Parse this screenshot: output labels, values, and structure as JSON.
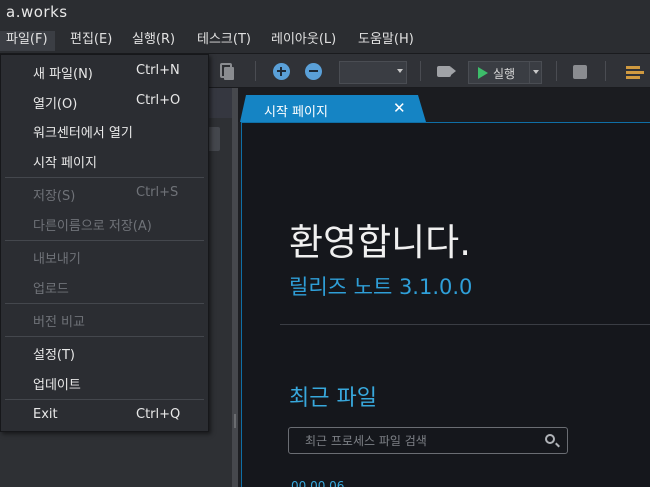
{
  "app": {
    "title": "a.works"
  },
  "menubar": [
    {
      "label": "파일(F)"
    },
    {
      "label": "편집(E)"
    },
    {
      "label": "실행(R)"
    },
    {
      "label": "테스크(T)"
    },
    {
      "label": "레이아웃(L)"
    },
    {
      "label": "도움말(H)"
    }
  ],
  "toolbar": {
    "zoom_value": "",
    "run_label": "실행"
  },
  "file_menu": {
    "items": [
      {
        "label": "새 파일(N)",
        "shortcut": "Ctrl+N",
        "enabled": true
      },
      {
        "label": "열기(O)",
        "shortcut": "Ctrl+O",
        "enabled": true
      },
      {
        "label": "워크센터에서 열기",
        "shortcut": "",
        "enabled": true
      },
      {
        "label": "시작 페이지",
        "shortcut": "",
        "enabled": true
      },
      {
        "label": "저장(S)",
        "shortcut": "Ctrl+S",
        "enabled": false
      },
      {
        "label": "다른이름으로 저장(A)",
        "shortcut": "",
        "enabled": false
      },
      {
        "label": "내보내기",
        "shortcut": "",
        "enabled": false
      },
      {
        "label": "업로드",
        "shortcut": "",
        "enabled": false
      },
      {
        "label": "버전 비교",
        "shortcut": "",
        "enabled": false
      },
      {
        "label": "설정(T)",
        "shortcut": "",
        "enabled": true
      },
      {
        "label": "업데이트",
        "shortcut": "",
        "enabled": true
      },
      {
        "label": "Exit",
        "shortcut": "Ctrl+Q",
        "enabled": true
      }
    ]
  },
  "editor": {
    "tab_label": "시작 페이지",
    "tab_close": "✕",
    "welcome": "환영합니다.",
    "release_notes": "릴리즈 노트  3.1.0.0",
    "recent_files_title": "최근 파일",
    "recent_search_placeholder": "최근 프로세스 파일 검색",
    "first_recent_date": "00.00.06"
  },
  "colors": {
    "accent": "#1584c4",
    "link": "#2f9fd8",
    "run": "#3dbd6a",
    "menu_bg": "#2b2d32",
    "editor_bg": "#15171c"
  }
}
